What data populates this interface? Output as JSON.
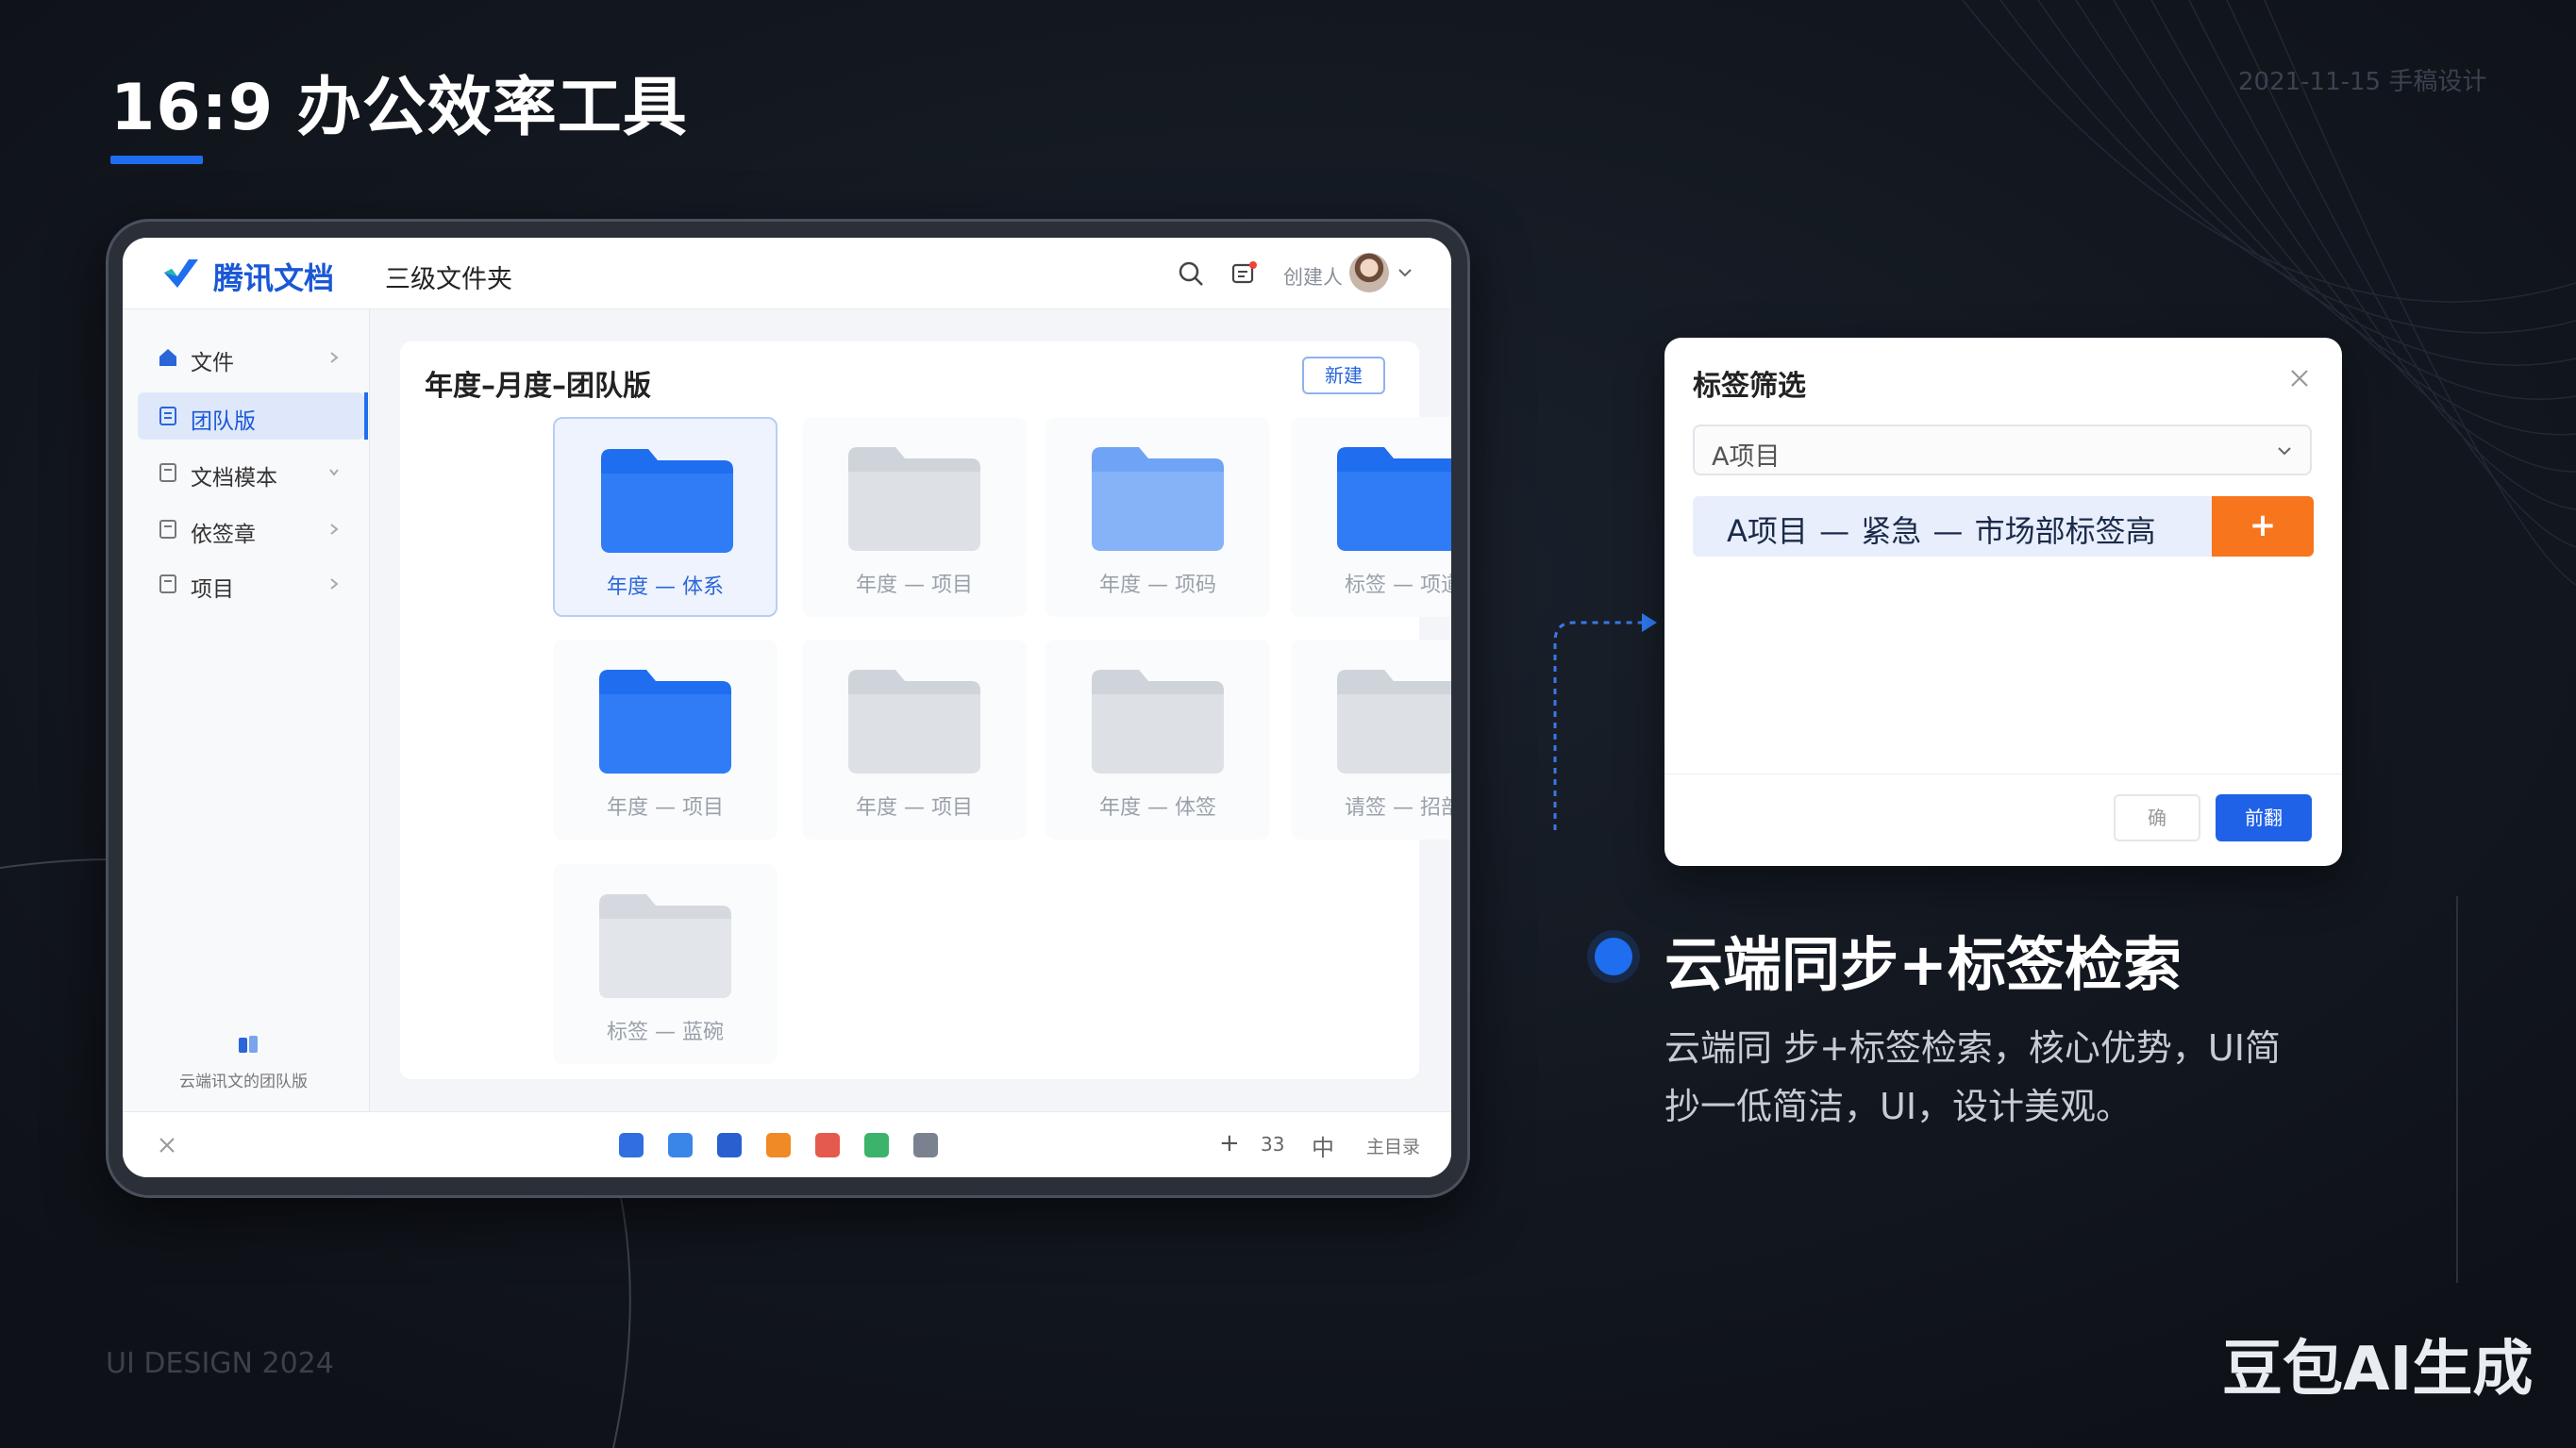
{
  "slide": {
    "title": "16:9 办公效率工具",
    "corner_tag": "2021-11-15 手稿设计",
    "footer_left": "UI DESIGN 2024",
    "footer_right": "豆包AI生成"
  },
  "app": {
    "name": "腾讯文档",
    "breadcrumb": "三级文件夹",
    "user_name": "创建人",
    "accent_color": "#1f6ef0"
  },
  "sidebar": {
    "items": [
      {
        "label": "文件",
        "icon": "home-icon"
      },
      {
        "label": "团队版",
        "icon": "doc-icon",
        "active": true
      },
      {
        "label": "文档模本",
        "icon": "doc-icon"
      },
      {
        "label": "依签章",
        "icon": "doc-icon"
      },
      {
        "label": "项目",
        "icon": "doc-icon"
      }
    ],
    "bottom_label": "云端讯文的团队版"
  },
  "main": {
    "title": "年度–月度–团队版",
    "new_button": "新建",
    "folders": [
      {
        "name": "年度 — 体系",
        "style": "blue",
        "selected": true
      },
      {
        "name": "年度 — 项目",
        "style": "gray"
      },
      {
        "name": "年度 — 项码",
        "style": "light-blue"
      },
      {
        "name": "标签 — 项道",
        "style": "blue"
      },
      {
        "name": "年度 — 项目",
        "style": "blue"
      },
      {
        "name": "年度 — 项目",
        "style": "gray"
      },
      {
        "name": "年度 — 体签",
        "style": "gray"
      },
      {
        "name": "请签 — 招部",
        "style": "gray"
      },
      {
        "name": "标签 — 蓝碗",
        "style": "gray"
      }
    ]
  },
  "bottombar": {
    "zoom_plus": "+",
    "zoom_value": "33",
    "zoom_fit": "中",
    "right_label": "主目录",
    "dock_colors": [
      "#2f6fe0",
      "#3a86e8",
      "#2a5fd0",
      "#f08a24",
      "#e55a4e",
      "#3bb36a",
      "#7a8290"
    ]
  },
  "dialog": {
    "title": "标签筛选",
    "select_value": "A项目",
    "tag_path": "A项目 — 紧急 — 市场部标签高",
    "add_button": "+",
    "cancel_button": "确",
    "confirm_button": "前翻"
  },
  "feature": {
    "heading": "云端同步+标签检索",
    "desc_line1": "云端同 步+标签检索，核心优势，UI简",
    "desc_line2": "抄一低简洁，UI，设计美观。"
  }
}
